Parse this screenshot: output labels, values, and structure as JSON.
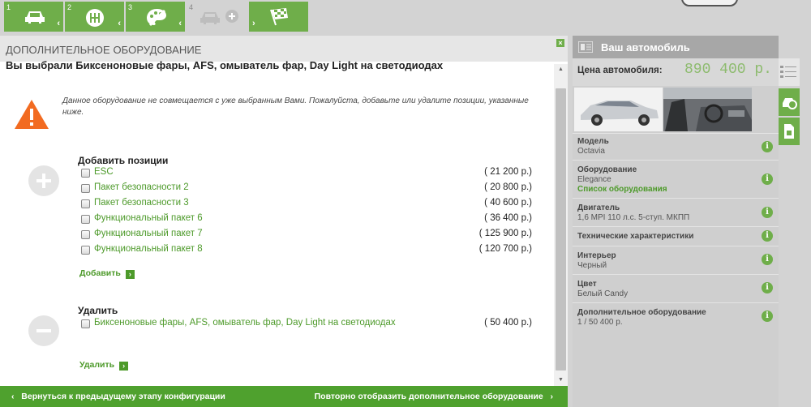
{
  "steps": [
    {
      "num": "1",
      "icon": "car-icon",
      "state": "done"
    },
    {
      "num": "2",
      "icon": "gearbox-icon",
      "state": "done"
    },
    {
      "num": "3",
      "icon": "palette-icon",
      "state": "done"
    },
    {
      "num": "4",
      "icon": "car-add-icon",
      "state": "current"
    },
    {
      "num": "",
      "icon": "checkered-flag-icon",
      "state": "next"
    }
  ],
  "main": {
    "header_title": "ДОПОЛНИТЕЛЬНОЕ ОБОРУДОВАНИЕ",
    "close_label": "×",
    "selected_text": "Вы выбрали Биксеноновые фары, AFS, омыватель фар, Day Light на светодиодах",
    "warning": "Данное оборудование не совмещается с уже выбранным Вами. Пожалуйста, добавьте или удалите позиции, указанные ниже.",
    "add_section": {
      "title": "Добавить позиции",
      "items": [
        {
          "label": "ESC",
          "price": "( 21 200 р.)"
        },
        {
          "label": "Пакет безопасности 2",
          "price": "( 20 800 р.)"
        },
        {
          "label": "Пакет безопасности 3",
          "price": "( 40 600 р.)"
        },
        {
          "label": "Функциональный пакет 6",
          "price": "( 36 400 р.)"
        },
        {
          "label": "Функциональный пакет 7",
          "price": "( 125 900 р.)"
        },
        {
          "label": "Функциональный пакет 8",
          "price": "( 120 700 р.)"
        }
      ],
      "action": "Добавить"
    },
    "remove_section": {
      "title": "Удалить",
      "items": [
        {
          "label": "Биксеноновые фары, AFS, омыватель фар, Day Light на светодиодах",
          "price": "( 50 400 р.)"
        }
      ],
      "action": "Удалить"
    }
  },
  "bottom_bar": {
    "back": "Вернуться к предыдущему этапу конфигурации",
    "forward": "Повторно отобразить дополнительное оборудование"
  },
  "sidebar": {
    "title": "Ваш автомобиль",
    "price_label": "Цена автомобиля:",
    "price_value": "890 400 р.",
    "specs": [
      {
        "key": "Модель",
        "value": "Octavia"
      },
      {
        "key": "Оборудование",
        "value": "Elegance",
        "link": "Список оборудования"
      },
      {
        "key": "Двигатель",
        "value": "1,6 MPI 110 л.с. 5-ступ. МКПП"
      },
      {
        "key": "Технические характеристики",
        "value": ""
      },
      {
        "key": "Интерьер",
        "value": "Черный"
      },
      {
        "key": "Цвет",
        "value": "Белый Candy"
      },
      {
        "key": "Дополнительное оборудование",
        "value": "1 / 50 400 р."
      }
    ],
    "info_label": "i"
  },
  "colors": {
    "accent": "#6fae4a",
    "link": "#4d9a2a",
    "warning": "#f26b21"
  }
}
